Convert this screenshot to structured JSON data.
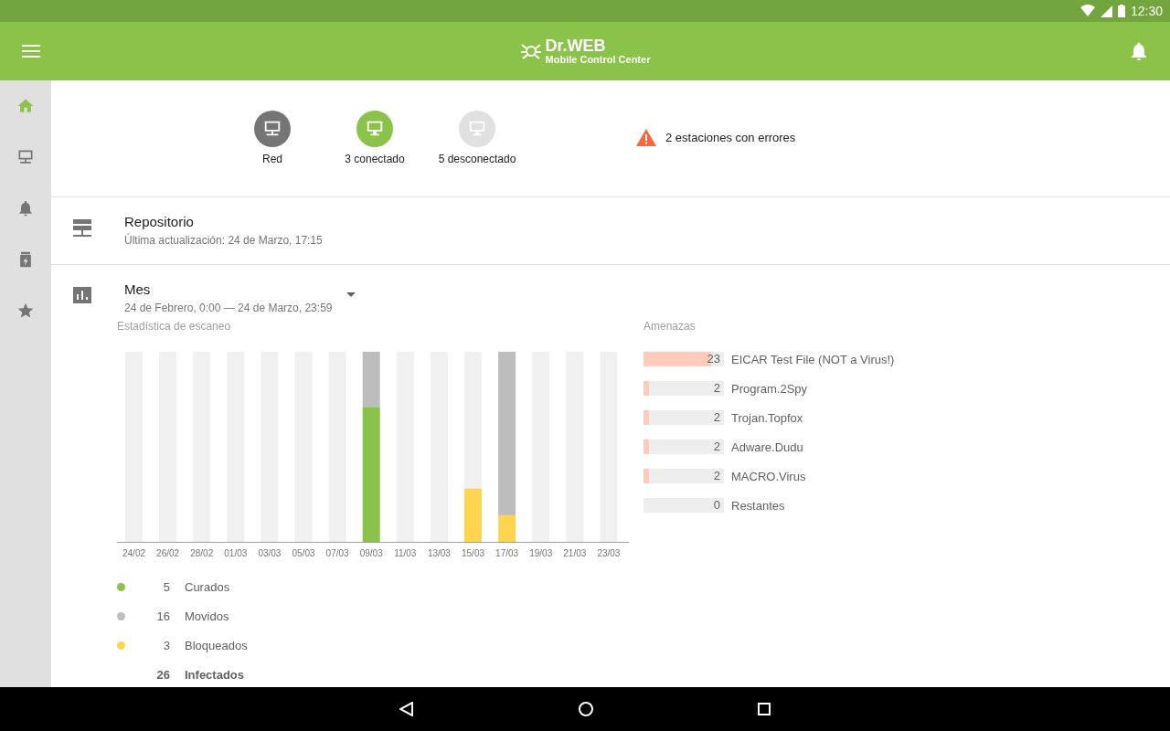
{
  "status_bar": {
    "time": "12:30"
  },
  "app_bar": {
    "brand": "Dr.WEB",
    "subtitle": "Mobile Control Center"
  },
  "sidebar": {
    "items": [
      {
        "kind": "home",
        "selected": true
      },
      {
        "kind": "stations",
        "selected": false
      },
      {
        "kind": "alerts",
        "selected": false
      },
      {
        "kind": "quarantine",
        "selected": false
      },
      {
        "kind": "favorites",
        "selected": false
      }
    ]
  },
  "stations": [
    {
      "kind": "network",
      "label": "Red"
    },
    {
      "kind": "connected",
      "label": "3 conectado"
    },
    {
      "kind": "disconnected",
      "label": "5 desconectado"
    }
  ],
  "warning": {
    "text": "2 estaciones con errores"
  },
  "repository": {
    "title": "Repositorio",
    "subtitle": "Última actualización: 24 de Marzo, 17:15"
  },
  "period": {
    "title": "Mes",
    "subtitle": "24 de Febrero, 0:00 — 24 de Marzo, 23:59"
  },
  "scan_stats": {
    "title": "Estadística de escaneo",
    "x_labels": [
      "24/02",
      "26/02",
      "28/02",
      "01/03",
      "03/03",
      "05/03",
      "07/03",
      "09/03",
      "11/03",
      "13/03",
      "15/03",
      "17/03",
      "19/03",
      "21/03",
      "23/03"
    ],
    "legend": [
      {
        "count": "5",
        "label": "Curados",
        "color": "#8bc34a"
      },
      {
        "count": "16",
        "label": "Movidos",
        "color": "#bdbdbd"
      },
      {
        "count": "3",
        "label": "Bloqueados",
        "color": "#ffd54f"
      }
    ],
    "total": {
      "count": "26",
      "label": "Infectados"
    }
  },
  "threats": {
    "title": "Amenazas",
    "items": [
      {
        "count": "23",
        "name": "EICAR Test File (NOT a Virus!)",
        "level": 0.84
      },
      {
        "count": "2",
        "name": "Program.2Spy",
        "level": 0.07
      },
      {
        "count": "2",
        "name": "Trojan.Topfox",
        "level": 0.07
      },
      {
        "count": "2",
        "name": "Adware.Dudu",
        "level": 0.07
      },
      {
        "count": "2",
        "name": "MACRO.Virus",
        "level": 0.07
      },
      {
        "count": "0",
        "name": "Restantes"
      }
    ]
  }
}
